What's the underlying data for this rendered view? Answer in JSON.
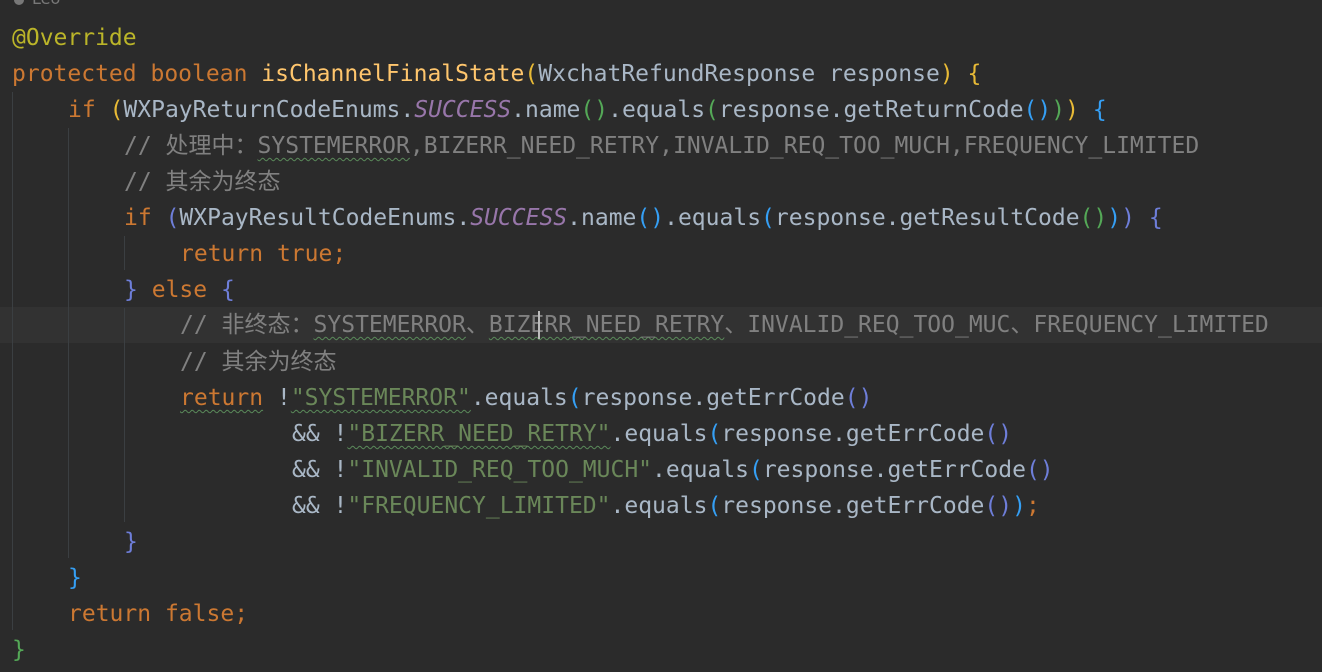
{
  "author": "Leo",
  "colors": {
    "background": "#2b2b2b",
    "keyword": "#cc7832",
    "annotation": "#bbb529",
    "method_decl": "#ffc66d",
    "constant": "#9876aa",
    "comment": "#808080",
    "string": "#6a8759",
    "plain": "#a9b7c6"
  },
  "icons": {
    "author": "person-icon"
  },
  "tok": {
    "override": "@Override",
    "protected": "protected",
    "boolean": "boolean",
    "method_name": "isChannelFinalState",
    "param": "WxchatRefundResponse response",
    "if": "if",
    "else": "else",
    "return": "return",
    "true": "true",
    "false": "false",
    "return_enums": "WXPayReturnCodeEnums.",
    "result_enums": "WXPayResultCodeEnums.",
    "success": "SUCCESS",
    "name": ".name",
    "equals": ".equals",
    "response_get_return": "response.getReturnCode",
    "response_get_result": "response.getResultCode",
    "response_get_err": "response.getErrCode",
    "and_not": "&& !",
    "bang": "!",
    "space": " ",
    "semicolon": ";",
    "open_paren": "(",
    "close_paren": ")",
    "open_brace": "{",
    "close_brace": "}",
    "paren_pair": "()"
  },
  "comments": {
    "c1_prefix": "// 处理中：",
    "c1_sys": "SYSTEMERROR",
    "c1_rest": ",BIZERR_NEED_RETRY,INVALID_REQ_TOO_MUCH,FREQUENCY_LIMITED",
    "rest_final": "// 其余为终态",
    "c2_prefix": "// 非终态：",
    "c2_sys": "SYSTEMERROR",
    "c2_sep": "、",
    "c2_biz": "BIZERR_NEED_RETRY",
    "c2_rest": "、INVALID_REQ_TOO_MUC、FREQUENCY_LIMITED"
  },
  "strings": {
    "s1": "\"SYSTEMERROR\"",
    "s2": "\"BIZERR_NEED_RETRY\"",
    "s3": "\"INVALID_REQ_TOO_MUCH\"",
    "s4": "\"FREQUENCY_LIMITED\""
  }
}
